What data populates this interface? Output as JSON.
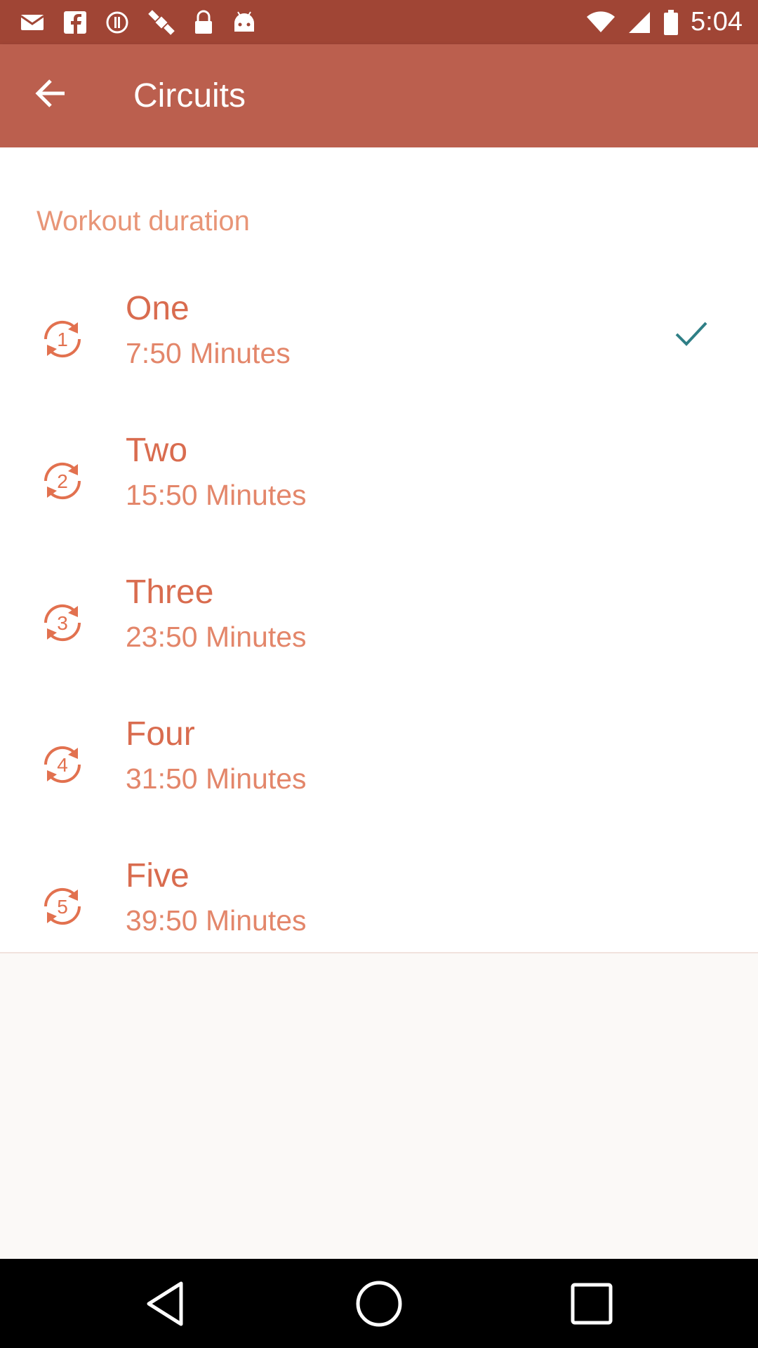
{
  "status_bar": {
    "time": "5:04",
    "icons": [
      "mail-icon",
      "facebook-icon",
      "alert-icon",
      "satellite-icon",
      "lock-icon",
      "android-icon",
      "wifi-icon",
      "signal-icon",
      "battery-icon"
    ]
  },
  "app_bar": {
    "title": "Circuits",
    "back_icon": "arrow-back-icon"
  },
  "list": {
    "header": "Workout duration",
    "items": [
      {
        "title": "One",
        "subtitle": "7:50 Minutes",
        "icon_number": "1",
        "selected": true
      },
      {
        "title": "Two",
        "subtitle": "15:50 Minutes",
        "icon_number": "2",
        "selected": false
      },
      {
        "title": "Three",
        "subtitle": "23:50 Minutes",
        "icon_number": "3",
        "selected": false
      },
      {
        "title": "Four",
        "subtitle": "31:50 Minutes",
        "icon_number": "4",
        "selected": false
      },
      {
        "title": "Five",
        "subtitle": "39:50 Minutes",
        "icon_number": "5",
        "selected": false
      }
    ]
  },
  "colors": {
    "status_bar": "#a04535",
    "app_bar": "#bb5f4e",
    "accent": "#e2714f",
    "check": "#2f7f86"
  },
  "nav_bar": {
    "icons": [
      "back-triangle-icon",
      "home-circle-icon",
      "recents-square-icon"
    ]
  }
}
